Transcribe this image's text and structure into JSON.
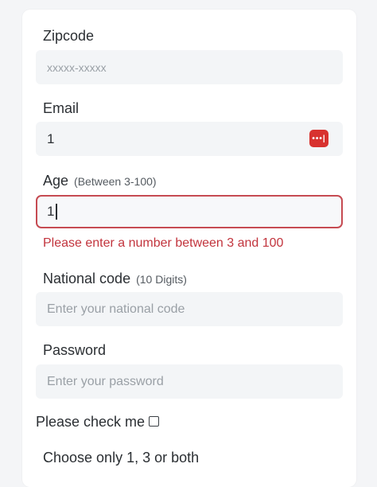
{
  "zipcode": {
    "label": "Zipcode",
    "placeholder": "xxxxx-xxxxx"
  },
  "email": {
    "label": "Email",
    "value": "1",
    "icon": "password-manager-icon",
    "icon_text": "•••|"
  },
  "age": {
    "label": "Age",
    "hint": "(Between 3-100)",
    "value": "1",
    "error": "Please enter a number between 3 and 100"
  },
  "national_code": {
    "label": "National code",
    "hint": "(10 Digits)",
    "placeholder": "Enter your national code"
  },
  "password": {
    "label": "Password",
    "placeholder": "Enter your password"
  },
  "check": {
    "label": "Please check me"
  },
  "choose": {
    "label": "Choose only 1, 3 or both"
  },
  "colors": {
    "error": "#c2343d",
    "field_bg": "#f3f5f7",
    "icon_bg": "#d8322f"
  }
}
